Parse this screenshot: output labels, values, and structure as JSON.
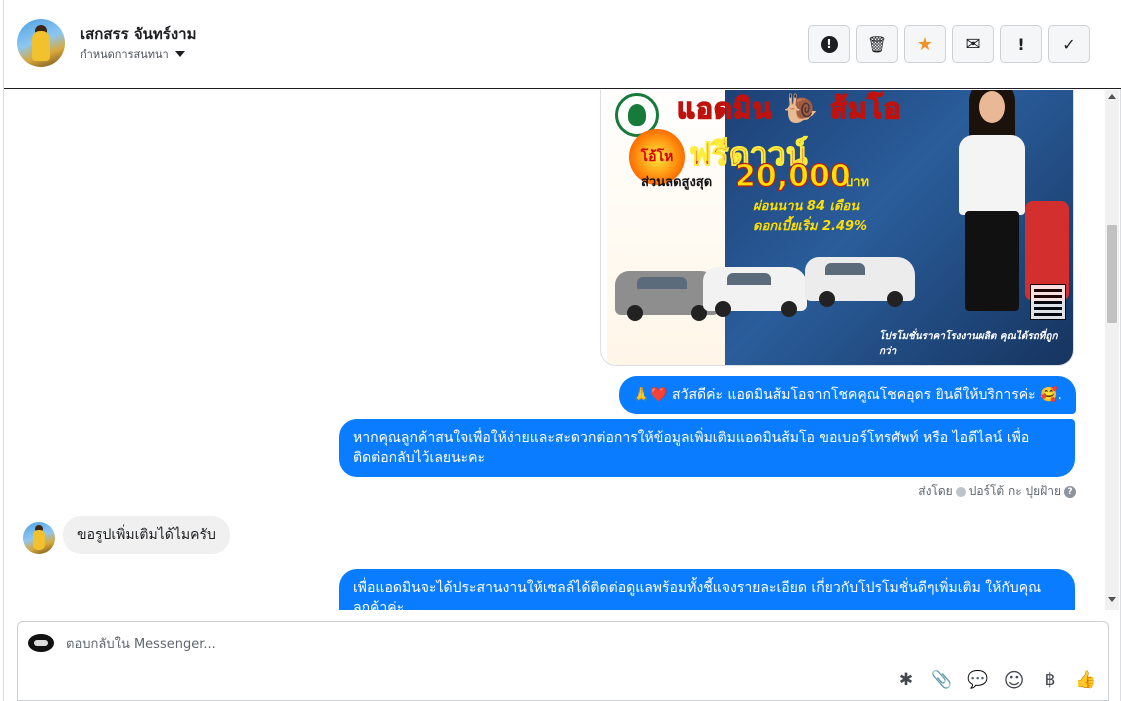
{
  "header": {
    "contact_name": "เสกสรร จันทร์งาม",
    "assign_label": "กำหนดการสนทนา",
    "actions": [
      {
        "name": "spam-button",
        "icon": "alert-circle-icon",
        "glyph": "!"
      },
      {
        "name": "delete-button",
        "icon": "trash-icon",
        "glyph": "🗑"
      },
      {
        "name": "star-button",
        "icon": "star-icon",
        "glyph": "★"
      },
      {
        "name": "mark-unread-button",
        "icon": "envelope-icon",
        "glyph": "✉"
      },
      {
        "name": "follow-up-button",
        "icon": "exclamation-icon",
        "glyph": "!"
      },
      {
        "name": "done-button",
        "icon": "check-icon",
        "glyph": "✓"
      }
    ],
    "star_color": "#f0932b"
  },
  "promo": {
    "title": "แอดมิน 🐌 ส้มโอ",
    "free_badge": "โอ้โห",
    "free_down": "ฟรีดาวน์",
    "discount_label": "ส่วนลดสูงสุด",
    "discount_amount": "20,000",
    "currency": "บาท",
    "installment": "ผ่อนนาน 84 เดือน",
    "interest": "ดอกเบี้ยเริ่ม 2.49%",
    "footer": "โปรโมชั่นราคาโรงงานผลิต คุณได้รถที่ถูกกว่า"
  },
  "messages": {
    "greeting": "🙏❤️ สวัสดีค่ะ แอดมินส้มโอจากโชคคูณโชคอุดร ยินดีให้บริการค่ะ 🥰.",
    "request_contact": "หากคุณลูกค้าสนใจเพื่อให้ง่ายและสะดวกต่อการให้ข้อมูลเพิ่มเติมแอดมินส้มโอ ขอเบอร์โทรศัพท์ หรือ ไอดีไลน์ เพื่อติดต่อกลับไว้เลยนะคะ",
    "sent_by_label": "ส่งโดย",
    "sender_name": "ปอร์โต้ กะ ปุยฝ้าย",
    "customer_reply": "ขอรูปเพิ่มเติมได้ไมครับ",
    "followup": "เพื่อแอดมินจะได้ประสานงานให้เซลล์ได้ติดต่อดูแลพร้อมทั้งชี้แจงรายละเอียด เกี่ยวกับโปรโมชั่นดีๆเพิ่มเติม ให้กับคุณลูกค้าค่ะ"
  },
  "composer": {
    "placeholder": "ตอบกลับใน Messenger...",
    "tools": [
      {
        "name": "saved-reply-button",
        "icon": "saved-reply-icon",
        "glyph": "✱"
      },
      {
        "name": "attach-button",
        "icon": "paperclip-icon",
        "glyph": "📎"
      },
      {
        "name": "quick-reply-button",
        "icon": "chat-bubble-icon",
        "glyph": "💬"
      },
      {
        "name": "emoji-button",
        "icon": "smiley-icon",
        "glyph": "☺"
      },
      {
        "name": "payment-button",
        "icon": "baht-icon",
        "glyph": "฿"
      },
      {
        "name": "like-button",
        "icon": "thumbs-up-icon",
        "glyph": "👍"
      }
    ]
  },
  "colors": {
    "outgoing_bubble": "#0a7cff",
    "incoming_bubble": "#f0f0f0"
  }
}
